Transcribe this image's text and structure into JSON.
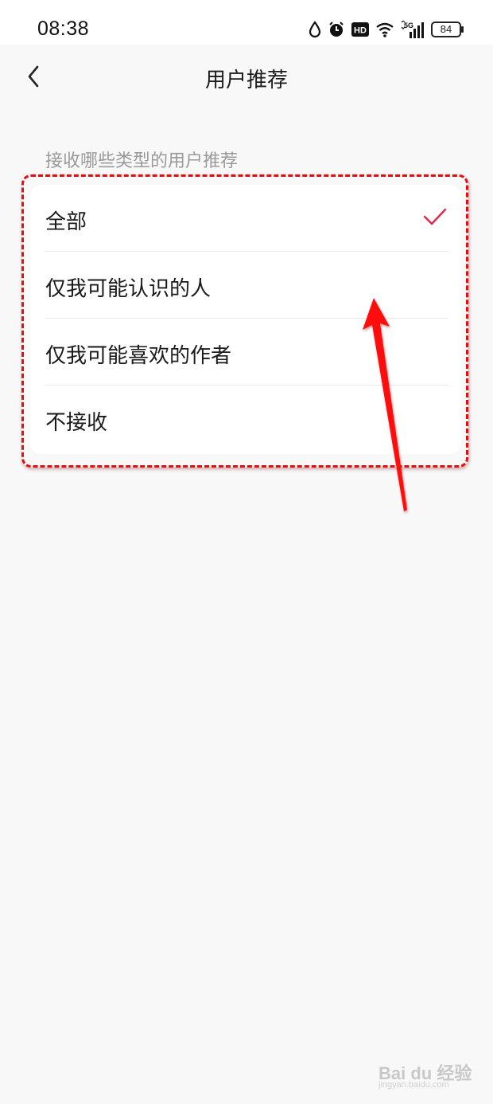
{
  "status_bar": {
    "time": "08:38",
    "icons": [
      "water-drop-icon",
      "alarm-icon",
      "hd-icon",
      "wifi-icon",
      "5g-signal-icon"
    ],
    "hd_label": "HD",
    "network_label": "5G",
    "battery": "84"
  },
  "header": {
    "back_icon": "chevron-left-icon",
    "title": "用户推荐"
  },
  "section": {
    "label": "接收哪些类型的用户推荐",
    "options": [
      {
        "label": "全部",
        "selected": true
      },
      {
        "label": "仅我可能认识的人",
        "selected": false
      },
      {
        "label": "仅我可能喜欢的作者",
        "selected": false
      },
      {
        "label": "不接收",
        "selected": false
      }
    ]
  },
  "annotation": {
    "highlight_color": "#e01010",
    "arrow_color": "#ff0000"
  },
  "watermark": {
    "main": "Bai du 经验",
    "sub": "jingyan.baidu.com"
  },
  "colors": {
    "background": "#f8f8f8",
    "card": "#ffffff",
    "check": "#e0284a",
    "section_label": "#9a9a9a"
  }
}
